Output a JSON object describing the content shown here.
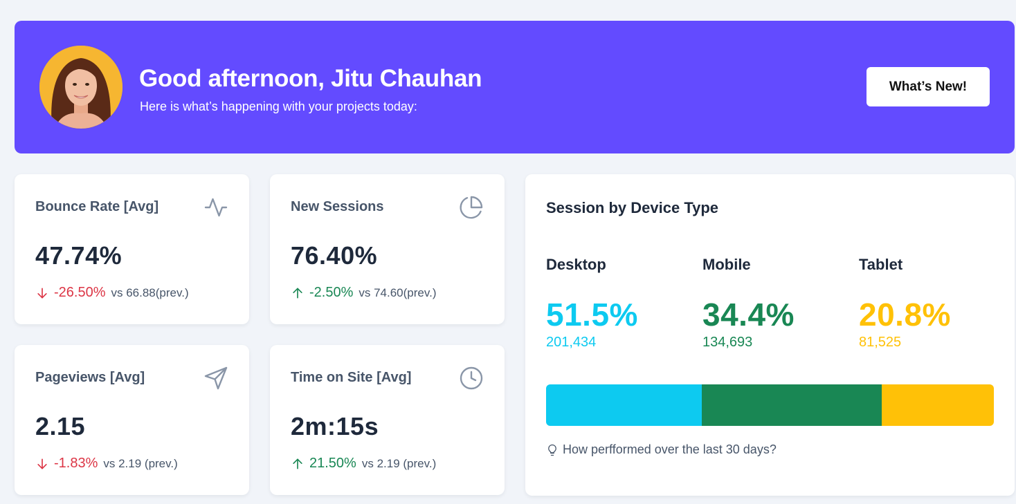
{
  "header": {
    "greeting": "Good afternoon, Jitu Chauhan",
    "subtitle": "Here is what’s happening with your projects today:",
    "button_label": "What’s New!",
    "accent_color": "#634bff"
  },
  "stats": [
    {
      "title": "Bounce Rate [Avg]",
      "icon": "activity-icon",
      "value": "47.74%",
      "direction": "down",
      "change": "-26.50%",
      "comparison": "vs 66.88(prev.)"
    },
    {
      "title": "New Sessions",
      "icon": "pie-chart-icon",
      "value": "76.40%",
      "direction": "up",
      "change": "-2.50%",
      "comparison": "vs 74.60(prev.)"
    },
    {
      "title": "Pageviews [Avg]",
      "icon": "send-icon",
      "value": "2.15",
      "direction": "down",
      "change": "-1.83%",
      "comparison": "vs 2.19 (prev.)"
    },
    {
      "title": "Time on Site [Avg]",
      "icon": "clock-icon",
      "value": "2m:15s",
      "direction": "up",
      "change": "21.50%",
      "comparison": "vs 2.19 (prev.)"
    }
  ],
  "devices": {
    "title": "Session by Device Type",
    "items": [
      {
        "name": "Desktop",
        "percent": "51.5%",
        "count": "201,434",
        "color": "#0dcaf0",
        "share": 0.348
      },
      {
        "name": "Mobile",
        "percent": "34.4%",
        "count": "134,693",
        "color": "#198754",
        "share": 0.401
      },
      {
        "name": "Tablet",
        "percent": "20.8%",
        "count": "81,525",
        "color": "#ffc107",
        "share": 0.251
      }
    ],
    "note": "How perfformed over the last 30 days?"
  }
}
